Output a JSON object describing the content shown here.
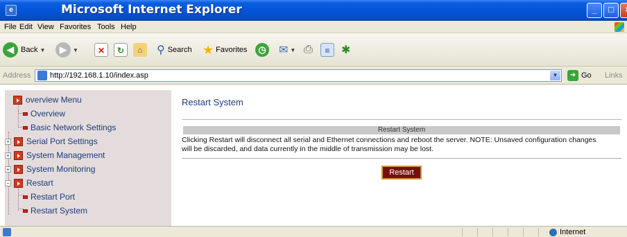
{
  "window": {
    "title": "Microsoft Internet Explorer",
    "icon": "ie-icon"
  },
  "menu": [
    "File",
    "Edit",
    "View",
    "Favorites",
    "Tools",
    "Help"
  ],
  "toolbar": {
    "back_label": "Back",
    "search_label": "Search",
    "favorites_label": "Favorites"
  },
  "address": {
    "label": "Address",
    "url": "http://192.168.1.10/index.asp",
    "go_label": "Go",
    "links_label": "Links"
  },
  "sidebar": {
    "root": "overview Menu",
    "items": [
      {
        "label": "Overview",
        "type": "leaf"
      },
      {
        "label": "Basic Network Settings",
        "type": "leaf"
      },
      {
        "label": "Serial Port Settings",
        "type": "folder",
        "expanded": false
      },
      {
        "label": "System Management",
        "type": "folder",
        "expanded": false
      },
      {
        "label": "System Monitoring",
        "type": "folder",
        "expanded": false
      },
      {
        "label": "Restart",
        "type": "folder",
        "expanded": true
      },
      {
        "label": "Restart Port",
        "type": "leaf"
      },
      {
        "label": "Restart System",
        "type": "leaf"
      }
    ]
  },
  "main": {
    "title": "Restart System",
    "section_header": "Restart System",
    "description": "Clicking Restart will disconnect all serial and Ethernet connections and reboot the server. NOTE: Unsaved configuration changes will be discarded, and data currently in the middle of transmission may be lost.",
    "restart_button": "Restart"
  },
  "status": {
    "zone": "Internet"
  },
  "colors": {
    "titlebar": "#0453d6",
    "sidebar_bg": "#e4dcdc",
    "link_text": "#1a3b7a",
    "restart_button_bg": "#7a0e0e"
  }
}
